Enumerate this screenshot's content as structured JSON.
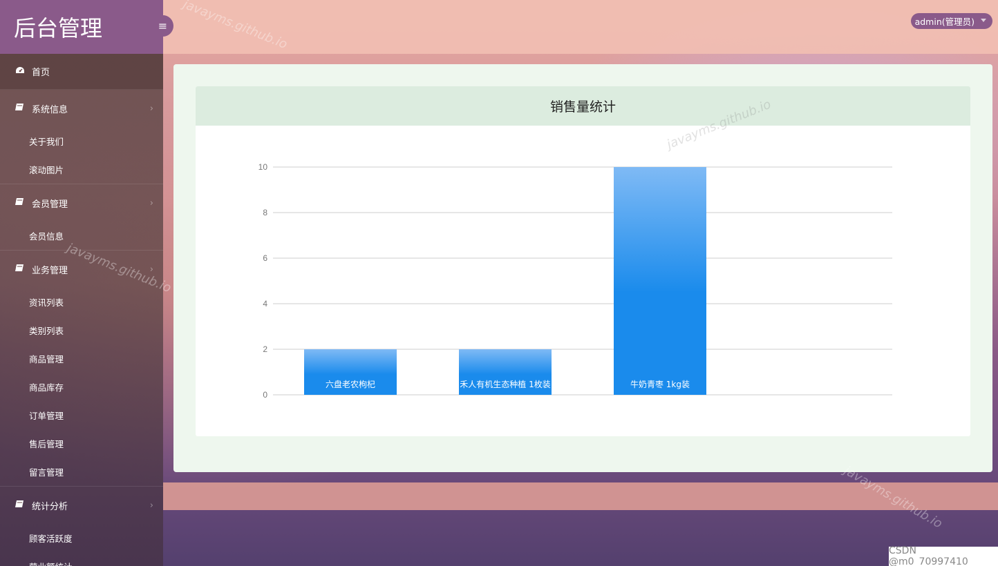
{
  "brand": {
    "title": "后台管理"
  },
  "header": {
    "user": "admin(管理员)"
  },
  "sidebar": {
    "home": "首页",
    "groups": [
      {
        "label": "系统信息",
        "items": [
          "关于我们",
          "滚动图片"
        ]
      },
      {
        "label": "会员管理",
        "items": [
          "会员信息"
        ]
      },
      {
        "label": "业务管理",
        "items": [
          "资讯列表",
          "类别列表",
          "商品管理",
          "商品库存",
          "订单管理",
          "售后管理",
          "留言管理"
        ]
      },
      {
        "label": "统计分析",
        "items": [
          "顾客活跃度",
          "营业额统计"
        ]
      }
    ]
  },
  "chart_data": {
    "type": "bar",
    "title": "销售量统计",
    "categories": [
      "六盘老农枸杞",
      "禾人有机生态种植 1枚装",
      "牛奶青枣 1kg装"
    ],
    "values": [
      2,
      2,
      10
    ],
    "yticks": [
      0,
      2,
      4,
      6,
      8,
      10
    ],
    "ylim": [
      0,
      10
    ],
    "grid": true,
    "colors": {
      "bar_top": "#7fbaf5",
      "bar_main": "#1a8bec",
      "grid": "#cccccc"
    }
  },
  "watermark": "javayms.github.io",
  "corner": "CSDN @m0_70997410",
  "colors": {
    "accent": "#8a5a8a",
    "topbar": "#f0beb2",
    "card": "#eef7ee"
  }
}
